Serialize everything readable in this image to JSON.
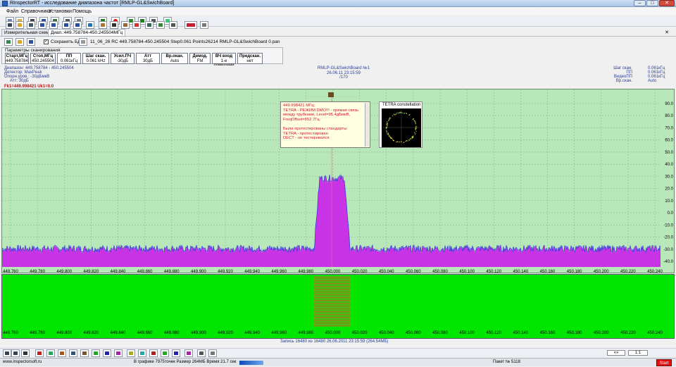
{
  "window": {
    "title": "RInspectorRT - исследование диапазона частот [RMLP-GL&SwichBoard]",
    "min_label": "–",
    "max_label": "□",
    "close_label": "✕"
  },
  "menu": [
    "Файл",
    "Справочники",
    "Установки",
    "Помощь"
  ],
  "tabs": {
    "measure_tab": "Измерительная схема",
    "range_tab": "Диап.:449.758784-450.245504МГц"
  },
  "db": {
    "save_label": "Сохранять БД",
    "record_info": "11_06_26 RC 449.758784-450.245504 Step0.061 Points26214 RMLP-GL&SwichBoard 0.pan"
  },
  "params": {
    "legend": "Параметры сканирования",
    "buttons": [
      {
        "label": "Старт,МГц",
        "value": "449.758784"
      },
      {
        "label": "Стоп,МГц",
        "value": "450.245504"
      },
      {
        "label": "ПП",
        "value": "0.061кГц"
      },
      {
        "label": "Шаг скан.",
        "value": "0.061 kHz"
      },
      {
        "label": "Усил.ПЧ",
        "value": "-30дБ"
      },
      {
        "label": "Атт",
        "value": "30дБ"
      },
      {
        "label": "Вр.окан.",
        "value": "Auto"
      },
      {
        "label": "Демод.",
        "value": "FM"
      },
      {
        "label": "ВЧ вход",
        "value": "1-е помещени"
      },
      {
        "label": "Предскан.",
        "value": "нет"
      }
    ]
  },
  "info": {
    "left": [
      "Диапазон: 449.758784 - 450.245504",
      "Детектор: MaxPeak",
      "Опорн.уров.: -30дБмкВ",
      "Атт: 30дБ"
    ],
    "center": [
      "RMLP-GL&SwichBoard №1",
      "26.06.11 23:15:59",
      "/170"
    ],
    "right_labels": [
      "Шаг скан.",
      "ПП",
      "ВидеоПП",
      "Вр.скан."
    ],
    "right_values": [
      "0.061кГц",
      "0.061кГц",
      "0.061кГц",
      "Auto"
    ],
    "marker": "Fk1=449.998421   Uk1=0.0"
  },
  "spectrum": {
    "x_ticks": [
      "449.760",
      "449.780",
      "449.800",
      "449.820",
      "449.840",
      "449.860",
      "449.880",
      "449.900",
      "449.920",
      "449.940",
      "449.960",
      "449.980",
      "450.000",
      "450.020",
      "450.040",
      "450.060",
      "450.080",
      "450.100",
      "450.120",
      "450.140",
      "450.160",
      "450.180",
      "450.200",
      "450.220",
      "450.240"
    ],
    "y_ticks": [
      "90.0",
      "80.0",
      "70.0",
      "60.0",
      "50.0",
      "40.0",
      "30.0",
      "20.0",
      "10.0",
      "0.0",
      "-10.0",
      "-20.0",
      "-30.0",
      "-40.0"
    ],
    "fill_color": "#c933e6",
    "trace_color": "#3b3bdc",
    "bg_color": "#b8e7b9",
    "signal_center_mhz": 450.0
  },
  "popup": {
    "message": "449.998421 МГц:\nTETRA - РЕЖИМ DMO!!! - прямая связь\nмежду трубками, Level=95.4дБмкВ,\nFreqOffset=852.7Гц.\n\nБыли протестированы стандарты:\nTETRA - протестирован\nDECT - не тестировался",
    "constellation_title": "TETRA constellation"
  },
  "waterfall": {
    "record_info": "Запись 16480 из 16480   26.06.2011 23:15:59 (264.54МБ)",
    "scale_label": "1:1"
  },
  "status": {
    "site": "www.inspectorsoft.ru",
    "graph_info": "В графике 7975точек  Размер 264МБ Время 21.7 сек",
    "packet": "Пакет № 5118",
    "start_label": "Start"
  }
}
